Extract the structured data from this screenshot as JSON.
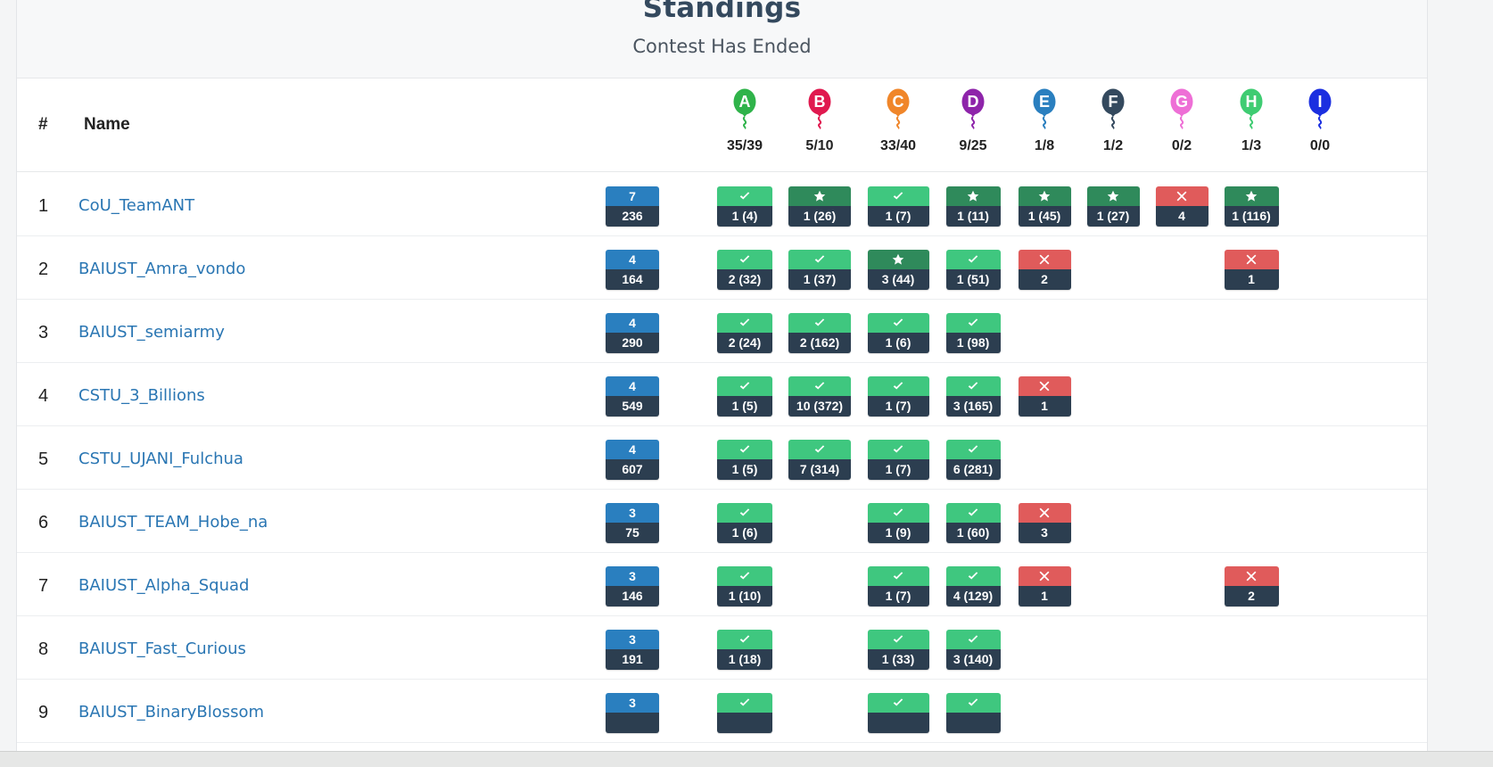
{
  "header": {
    "title": "Standings",
    "subtitle": "Contest Has Ended"
  },
  "columns": {
    "rank": "#",
    "name": "Name"
  },
  "problems": [
    {
      "letter": "A",
      "stat": "35/39",
      "color": "#2fb34a"
    },
    {
      "letter": "B",
      "stat": "5/10",
      "color": "#e0194f"
    },
    {
      "letter": "C",
      "stat": "33/40",
      "color": "#f0862a"
    },
    {
      "letter": "D",
      "stat": "9/25",
      "color": "#8e24aa"
    },
    {
      "letter": "E",
      "stat": "1/8",
      "color": "#2a7fbf"
    },
    {
      "letter": "F",
      "stat": "1/2",
      "color": "#34495e"
    },
    {
      "letter": "G",
      "stat": "0/2",
      "color": "#ee6fd6"
    },
    {
      "letter": "H",
      "stat": "1/3",
      "color": "#3fcc72"
    },
    {
      "letter": "I",
      "stat": "0/0",
      "color": "#1b2fe0"
    }
  ],
  "rows": [
    {
      "rank": "1",
      "team": "CoU_TeamANT",
      "solved": "7",
      "penalty": "236",
      "cells": [
        {
          "p": 0,
          "type": "solved",
          "text": "1 (4)"
        },
        {
          "p": 1,
          "type": "first",
          "text": "1 (26)"
        },
        {
          "p": 2,
          "type": "solved",
          "text": "1 (7)"
        },
        {
          "p": 3,
          "type": "first",
          "text": "1 (11)"
        },
        {
          "p": 4,
          "type": "first",
          "text": "1 (45)"
        },
        {
          "p": 5,
          "type": "first",
          "text": "1 (27)"
        },
        {
          "p": 6,
          "type": "wrong",
          "text": "4"
        },
        {
          "p": 7,
          "type": "first",
          "text": "1 (116)"
        }
      ]
    },
    {
      "rank": "2",
      "team": "BAIUST_Amra_vondo",
      "solved": "4",
      "penalty": "164",
      "cells": [
        {
          "p": 0,
          "type": "solved",
          "text": "2 (32)"
        },
        {
          "p": 1,
          "type": "solved",
          "text": "1 (37)"
        },
        {
          "p": 2,
          "type": "first",
          "text": "3 (44)"
        },
        {
          "p": 3,
          "type": "solved",
          "text": "1 (51)"
        },
        {
          "p": 4,
          "type": "wrong",
          "text": "2"
        },
        {
          "p": 7,
          "type": "wrong",
          "text": "1"
        }
      ]
    },
    {
      "rank": "3",
      "team": "BAIUST_semiarmy",
      "solved": "4",
      "penalty": "290",
      "cells": [
        {
          "p": 0,
          "type": "solved",
          "text": "2 (24)"
        },
        {
          "p": 1,
          "type": "solved",
          "text": "2 (162)"
        },
        {
          "p": 2,
          "type": "solved",
          "text": "1 (6)"
        },
        {
          "p": 3,
          "type": "solved",
          "text": "1 (98)"
        }
      ]
    },
    {
      "rank": "4",
      "team": "CSTU_3_Billions",
      "solved": "4",
      "penalty": "549",
      "cells": [
        {
          "p": 0,
          "type": "solved",
          "text": "1 (5)"
        },
        {
          "p": 1,
          "type": "solved",
          "text": "10 (372)"
        },
        {
          "p": 2,
          "type": "solved",
          "text": "1 (7)"
        },
        {
          "p": 3,
          "type": "solved",
          "text": "3 (165)"
        },
        {
          "p": 4,
          "type": "wrong",
          "text": "1"
        }
      ]
    },
    {
      "rank": "5",
      "team": "CSTU_UJANI_Fulchua",
      "solved": "4",
      "penalty": "607",
      "cells": [
        {
          "p": 0,
          "type": "solved",
          "text": "1 (5)"
        },
        {
          "p": 1,
          "type": "solved",
          "text": "7 (314)"
        },
        {
          "p": 2,
          "type": "solved",
          "text": "1 (7)"
        },
        {
          "p": 3,
          "type": "solved",
          "text": "6 (281)"
        }
      ]
    },
    {
      "rank": "6",
      "team": "BAIUST_TEAM_Hobe_na",
      "solved": "3",
      "penalty": "75",
      "cells": [
        {
          "p": 0,
          "type": "solved",
          "text": "1 (6)"
        },
        {
          "p": 2,
          "type": "solved",
          "text": "1 (9)"
        },
        {
          "p": 3,
          "type": "solved",
          "text": "1 (60)"
        },
        {
          "p": 4,
          "type": "wrong",
          "text": "3"
        }
      ]
    },
    {
      "rank": "7",
      "team": "BAIUST_Alpha_Squad",
      "solved": "3",
      "penalty": "146",
      "cells": [
        {
          "p": 0,
          "type": "solved",
          "text": "1 (10)"
        },
        {
          "p": 2,
          "type": "solved",
          "text": "1 (7)"
        },
        {
          "p": 3,
          "type": "solved",
          "text": "4 (129)"
        },
        {
          "p": 4,
          "type": "wrong",
          "text": "1"
        },
        {
          "p": 7,
          "type": "wrong",
          "text": "2"
        }
      ]
    },
    {
      "rank": "8",
      "team": "BAIUST_Fast_Curious",
      "solved": "3",
      "penalty": "191",
      "cells": [
        {
          "p": 0,
          "type": "solved",
          "text": "1 (18)"
        },
        {
          "p": 2,
          "type": "solved",
          "text": "1 (33)"
        },
        {
          "p": 3,
          "type": "solved",
          "text": "3 (140)"
        }
      ]
    },
    {
      "rank": "9",
      "team": "BAIUST_BinaryBlossom",
      "solved": "3",
      "penalty": "",
      "cells": [
        {
          "p": 0,
          "type": "solved",
          "text": ""
        },
        {
          "p": 2,
          "type": "solved",
          "text": ""
        },
        {
          "p": 3,
          "type": "solved",
          "text": ""
        }
      ]
    }
  ],
  "icons": {
    "solved": "check-icon",
    "first": "star-icon",
    "wrong": "cross-icon"
  }
}
